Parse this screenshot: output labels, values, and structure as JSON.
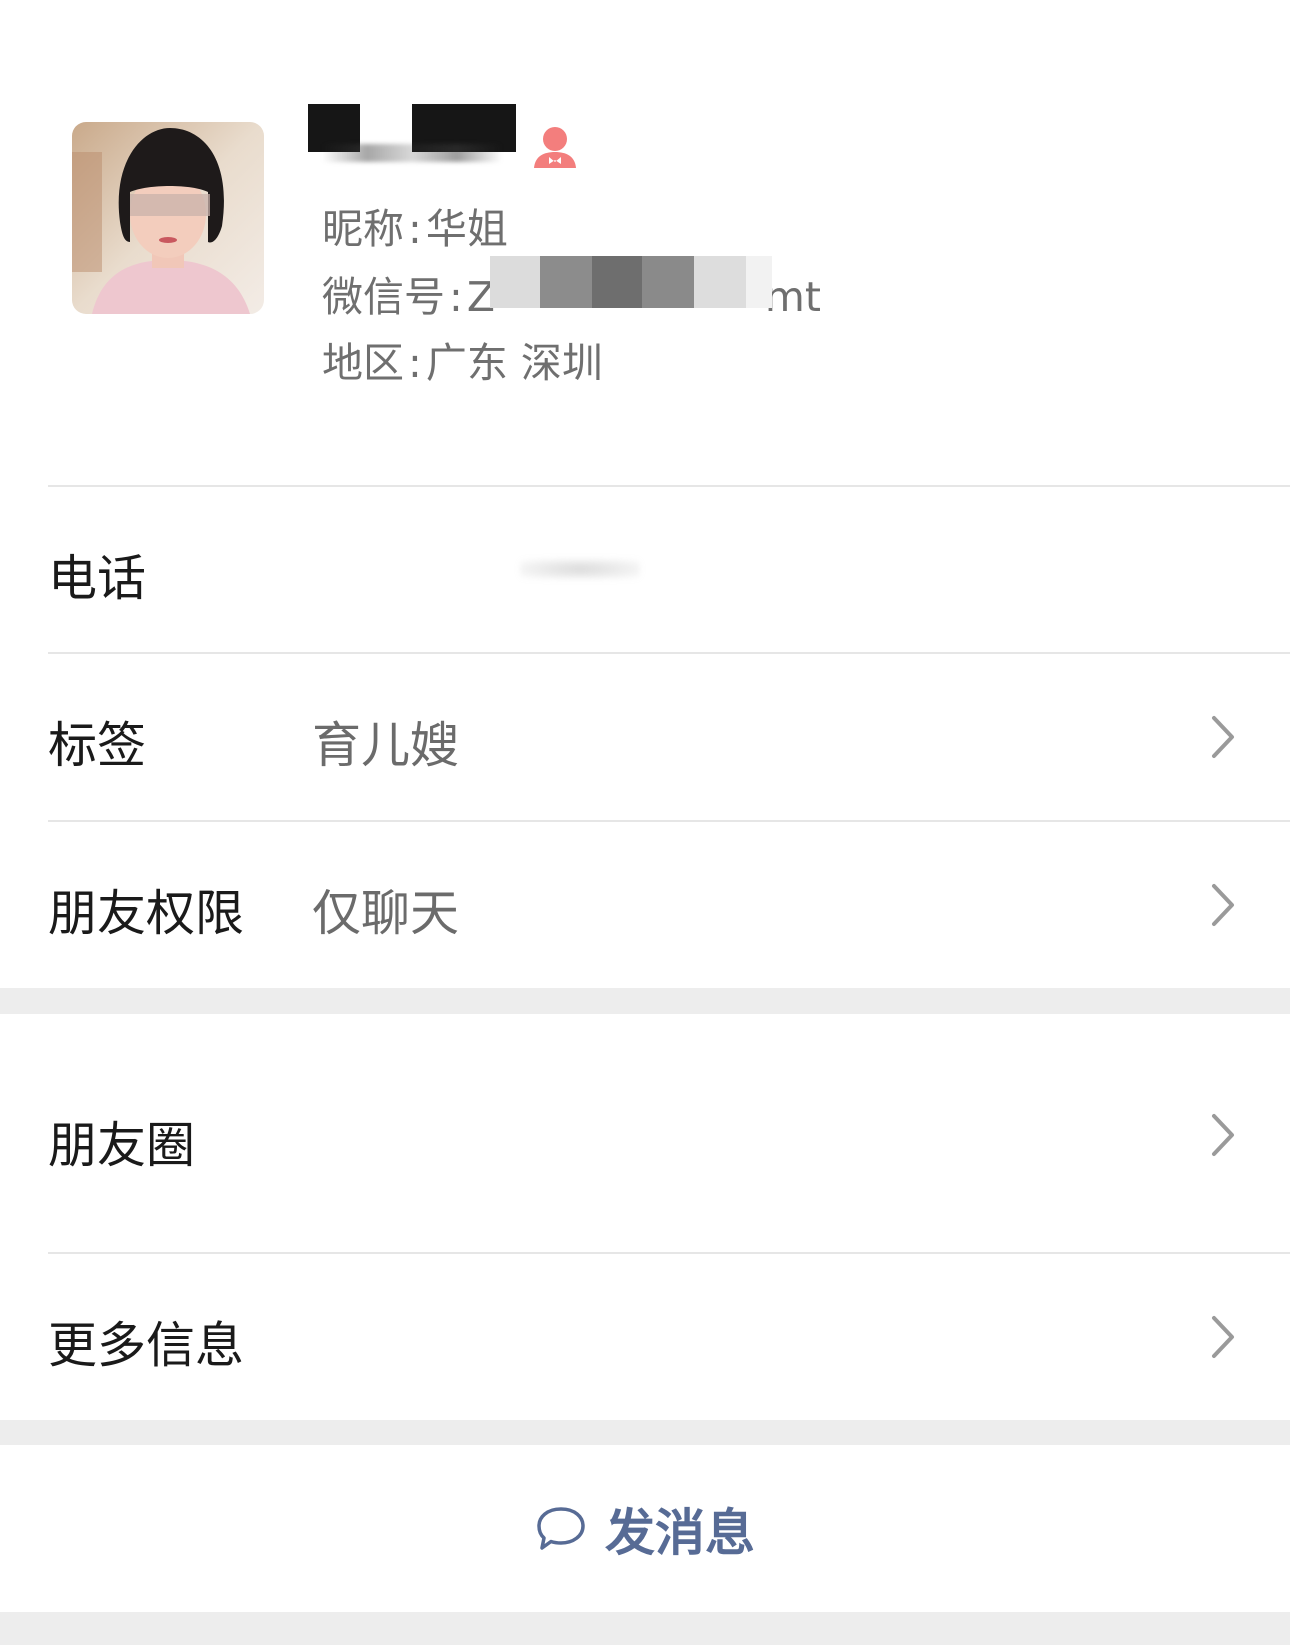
{
  "profile": {
    "display_name_visible": "",
    "gender_icon": "female-icon",
    "nickname_label": "昵称",
    "nickname_value": "华姐",
    "wechat_id_label": "微信号",
    "wechat_id_prefix": "Z",
    "wechat_id_suffix": "mt",
    "region_label": "地区",
    "region_value": "广东 深圳",
    "colon": ":"
  },
  "rows": {
    "phone": {
      "label": "电话",
      "value": ""
    },
    "tags": {
      "label": "标签",
      "value": "育儿嫂"
    },
    "permissions": {
      "label": "朋友权限",
      "value": "仅聊天"
    },
    "moments": {
      "label": "朋友圈"
    },
    "more_info": {
      "label": "更多信息"
    }
  },
  "actions": {
    "send_message_label": "发消息",
    "send_message_icon": "chat-bubble-icon"
  },
  "colors": {
    "link_blue": "#576b95",
    "female_pink": "#f37e7d",
    "background": "#ededed",
    "divider": "#e6e6e6"
  }
}
